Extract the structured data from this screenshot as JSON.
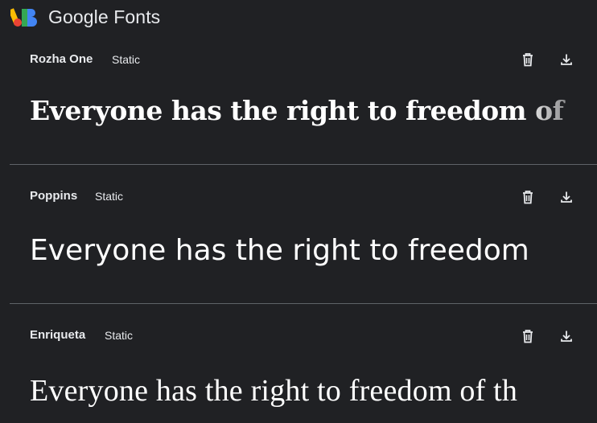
{
  "app": {
    "title": "Google Fonts",
    "logo_icon": "google-fonts-logo-icon"
  },
  "fonts": [
    {
      "name": "Rozha One",
      "type": "Static",
      "sample": "Everyone has the right to freedom of",
      "actions": [
        "delete-icon",
        "download-icon"
      ]
    },
    {
      "name": "Poppins",
      "type": "Static",
      "sample": "Everyone has the right to freedom",
      "actions": [
        "delete-icon",
        "download-icon"
      ]
    },
    {
      "name": "Enriqueta",
      "type": "Static",
      "sample": "Everyone has the right to freedom of th",
      "actions": [
        "delete-icon",
        "download-icon"
      ]
    }
  ],
  "colors": {
    "background": "#202124",
    "text": "#e8eaed",
    "divider": "#5f6368",
    "logo_blue": "#4285f4",
    "logo_green": "#34a853",
    "logo_yellow": "#fbbc04",
    "logo_red": "#ea4335"
  }
}
